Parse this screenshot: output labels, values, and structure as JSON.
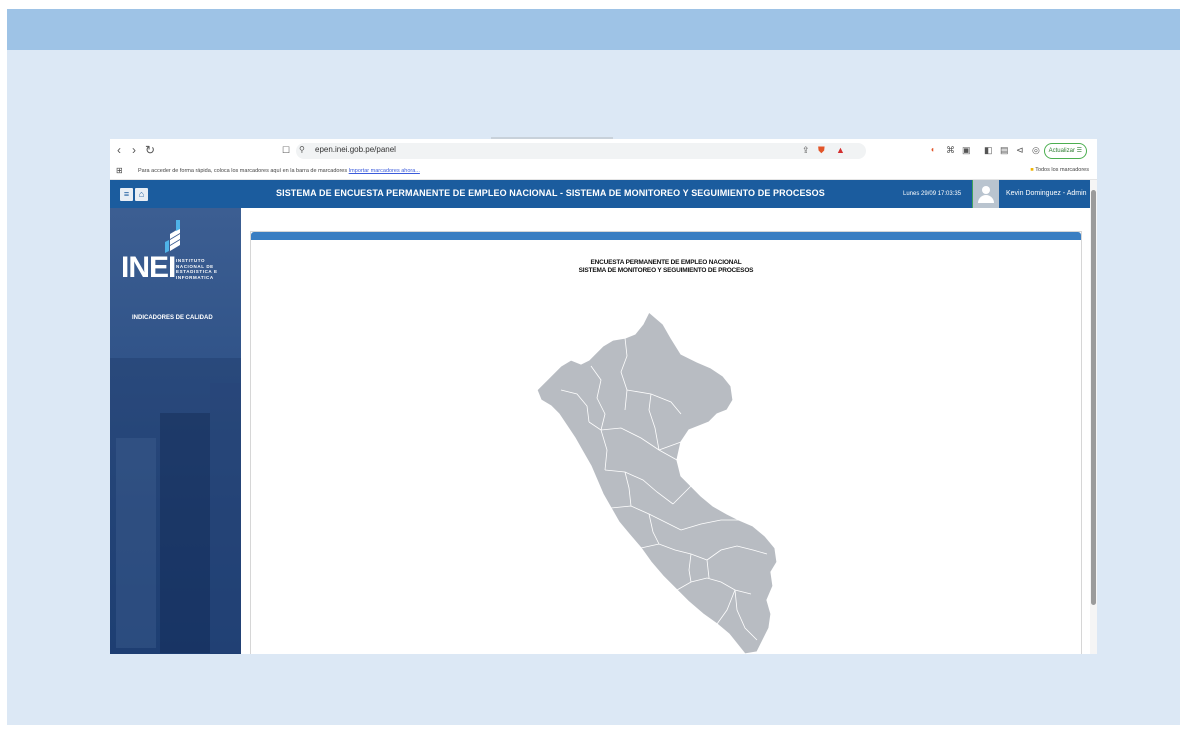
{
  "browser": {
    "url": "epen.inei.gob.pe/panel",
    "bookmarks_hint": "Para acceder de forma rápida, coloca los marcadores aquí en la barra de marcadores",
    "import_link": "Importar marcadores ahora...",
    "all_bookmarks": "Todos los marcadores",
    "update_button": "Actualizar"
  },
  "header": {
    "title": "SISTEMA DE ENCUESTA PERMANENTE DE EMPLEO NACIONAL - SISTEMA DE MONITOREO Y SEGUIMIENTO DE PROCESOS",
    "datetime": "Lunes 29/09 17:03:35",
    "user": "Kevin Dominguez - Admin"
  },
  "sidebar": {
    "logo": "INEI",
    "logo_sub": [
      "INSTITUTO",
      "NACIONAL DE",
      "ESTADISTICA E",
      "INFORMATICA"
    ],
    "menu_item": "INDICADORES DE CALIDAD"
  },
  "panel": {
    "title_line1": "ENCUESTA PERMANENTE DE EMPLEO NACIONAL",
    "title_line2": "SISTEMA DE MONITOREO Y SEGUIMIENTO DE PROCESOS"
  },
  "colors": {
    "header": "#1b5c9e",
    "panel_bar": "#3a7ec2",
    "map_fill": "#b8bcc2",
    "slide_band": "#9ec3e6"
  }
}
